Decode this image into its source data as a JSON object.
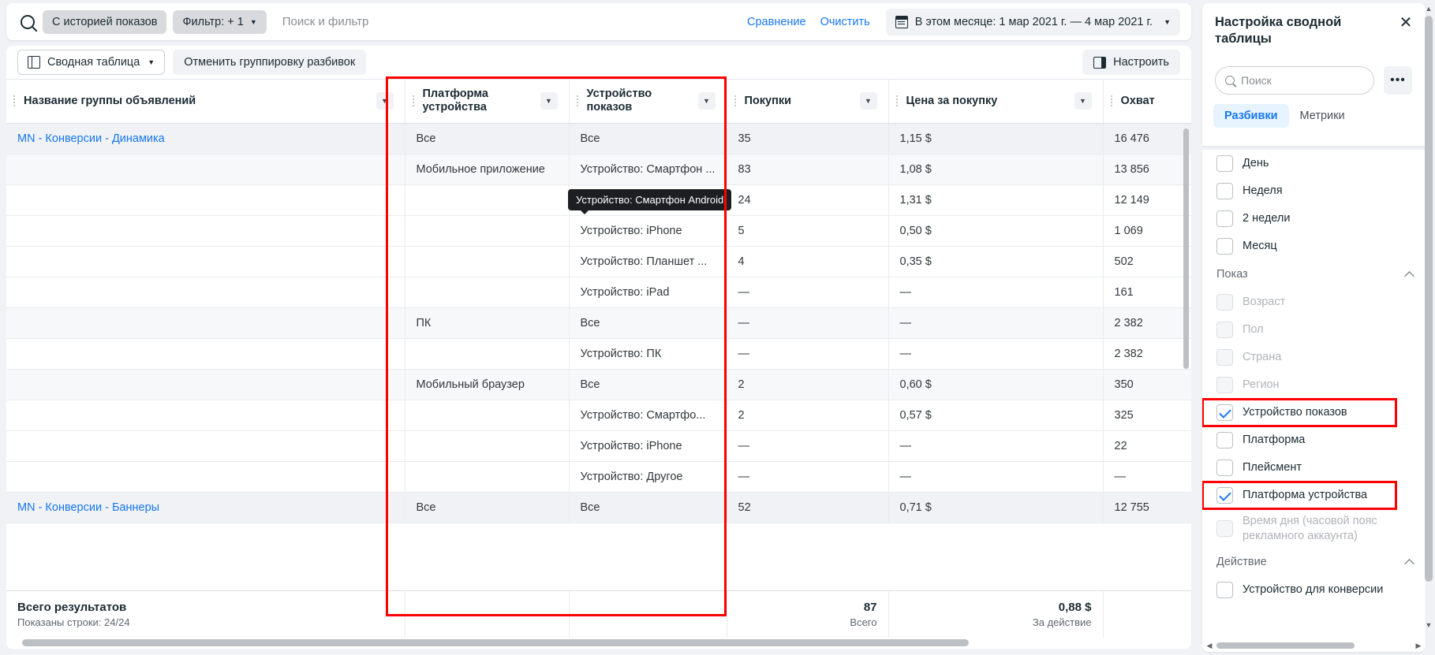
{
  "filter_bar": {
    "search_icon": "search-icon",
    "chip_history": "С историей показов",
    "chip_filter": "Фильтр: + 1",
    "search_placeholder": "Поиск и фильтр",
    "compare_link": "Сравнение",
    "clear_link": "Очистить",
    "calendar_icon": "calendar-icon",
    "date_range": "В этом месяце: 1 мар 2021 г. — 4 мар 2021 г.",
    "caret": "▼"
  },
  "toolbar": {
    "pivot_icon": "pivot-table-icon",
    "pivot_label": "Сводная таблица",
    "ungroup_label": "Отменить группировку разбивок",
    "adjust_icon": "adjust-columns-icon",
    "adjust_label": "Настроить"
  },
  "table": {
    "columns": [
      "Название группы объявлений",
      "Платформа устройства",
      "Устройство показов",
      "Покупки",
      "Цена за покупку",
      "Охват"
    ],
    "rows": [
      {
        "adset": "MN - Конверсии - Динамика",
        "platform": "Все",
        "device": "Все",
        "purchases": "35",
        "cpp": "1,15 $",
        "reach": "16 476",
        "shade": "strong"
      },
      {
        "adset": "",
        "platform": "Мобильное приложение",
        "device": "Устройство: Смартфон ...",
        "purchases": "83",
        "cpp": "1,08 $",
        "reach": "13 856",
        "shade": "light"
      },
      {
        "adset": "",
        "platform": "",
        "device": "Устройство: Смартфо...",
        "purchases": "24",
        "cpp": "1,31 $",
        "reach": "12 149",
        "shade": "none"
      },
      {
        "adset": "",
        "platform": "",
        "device": "Устройство: iPhone",
        "purchases": "5",
        "cpp": "0,50 $",
        "reach": "1 069",
        "shade": "none"
      },
      {
        "adset": "",
        "platform": "",
        "device": "Устройство: Планшет ...",
        "purchases": "4",
        "cpp": "0,35 $",
        "reach": "502",
        "shade": "none"
      },
      {
        "adset": "",
        "platform": "",
        "device": "Устройство: iPad",
        "purchases": "—",
        "cpp": "—",
        "reach": "161",
        "shade": "none"
      },
      {
        "adset": "",
        "platform": "ПК",
        "device": "Все",
        "purchases": "—",
        "cpp": "—",
        "reach": "2 382",
        "shade": "light"
      },
      {
        "adset": "",
        "platform": "",
        "device": "Устройство: ПК",
        "purchases": "—",
        "cpp": "—",
        "reach": "2 382",
        "shade": "none"
      },
      {
        "adset": "",
        "platform": "Мобильный браузер",
        "device": "Все",
        "purchases": "2",
        "cpp": "0,60 $",
        "reach": "350",
        "shade": "light"
      },
      {
        "adset": "",
        "platform": "",
        "device": "Устройство: Смартфо...",
        "purchases": "2",
        "cpp": "0,57 $",
        "reach": "325",
        "shade": "none"
      },
      {
        "adset": "",
        "platform": "",
        "device": "Устройство: iPhone",
        "purchases": "—",
        "cpp": "—",
        "reach": "22",
        "shade": "none"
      },
      {
        "adset": "",
        "platform": "",
        "device": "Устройство: Другое",
        "purchases": "—",
        "cpp": "—",
        "reach": "—",
        "shade": "none"
      },
      {
        "adset": "MN - Конверсии - Баннеры",
        "platform": "Все",
        "device": "Все",
        "purchases": "52",
        "cpp": "0,71 $",
        "reach": "12 755",
        "shade": "strong"
      }
    ],
    "tooltip": "Устройство: Смартфон Android",
    "footer": {
      "title": "Всего результатов",
      "subtitle": "Показаны строки: 24/24",
      "purchases_total": "87",
      "purchases_total_label": "Всего",
      "cpp_total": "0,88 $",
      "cpp_total_label": "За действие"
    }
  },
  "panel": {
    "title": "Настройка сводной таблицы",
    "close_icon": "close-icon",
    "search_icon": "search-icon",
    "search_placeholder": "Поиск",
    "more_icon": "more-options-icon",
    "tabs": [
      {
        "label": "Разбивки",
        "active": true
      },
      {
        "label": "Метрики",
        "active": false
      }
    ],
    "items_top": [
      {
        "label": "День",
        "checked": false,
        "disabled": false
      },
      {
        "label": "Неделя",
        "checked": false,
        "disabled": false
      },
      {
        "label": "2 недели",
        "checked": false,
        "disabled": false
      },
      {
        "label": "Месяц",
        "checked": false,
        "disabled": false
      }
    ],
    "section_pokaz": {
      "label": "Показ",
      "collapse_icon": "chevron-up-icon"
    },
    "items_pokaz": [
      {
        "label": "Возраст",
        "checked": false,
        "disabled": true,
        "highlight": false
      },
      {
        "label": "Пол",
        "checked": false,
        "disabled": true,
        "highlight": false
      },
      {
        "label": "Страна",
        "checked": false,
        "disabled": true,
        "highlight": false
      },
      {
        "label": "Регион",
        "checked": false,
        "disabled": true,
        "highlight": false
      },
      {
        "label": "Устройство показов",
        "checked": true,
        "disabled": false,
        "highlight": true
      },
      {
        "label": "Платформа",
        "checked": false,
        "disabled": false,
        "highlight": false
      },
      {
        "label": "Плейсмент",
        "checked": false,
        "disabled": false,
        "highlight": false
      },
      {
        "label": "Платформа устройства",
        "checked": true,
        "disabled": false,
        "highlight": true
      },
      {
        "label": "Время дня (часовой пояс рекламного аккаунта)",
        "checked": false,
        "disabled": true,
        "highlight": false
      }
    ],
    "section_action": {
      "label": "Действие",
      "collapse_icon": "chevron-up-icon"
    },
    "items_action": [
      {
        "label": "Устройство для конверсии",
        "checked": false,
        "disabled": false,
        "highlight": false
      }
    ]
  },
  "colors": {
    "accent_blue": "#1877f2",
    "annotation_red": "#ff0000",
    "panel_tab_bg": "#e7f3ff",
    "tooltip_bg": "#1c1e21"
  }
}
